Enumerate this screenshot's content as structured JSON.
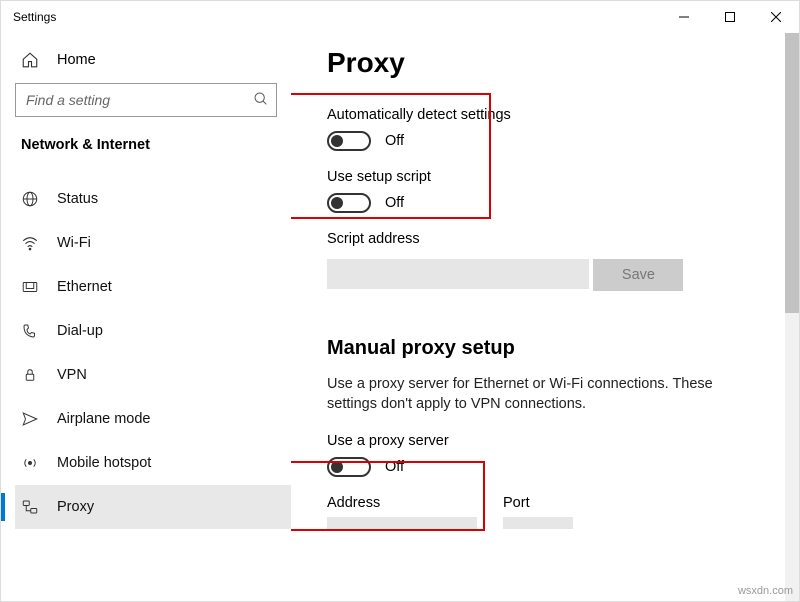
{
  "titlebar": {
    "label": "Settings"
  },
  "sidebar": {
    "home": "Home",
    "search_placeholder": "Find a setting",
    "section": "Network & Internet",
    "items": [
      {
        "label": "Status"
      },
      {
        "label": "Wi-Fi"
      },
      {
        "label": "Ethernet"
      },
      {
        "label": "Dial-up"
      },
      {
        "label": "VPN"
      },
      {
        "label": "Airplane mode"
      },
      {
        "label": "Mobile hotspot"
      },
      {
        "label": "Proxy"
      }
    ]
  },
  "main": {
    "title": "Proxy",
    "auto_detect": {
      "label": "Automatically detect settings",
      "state": "Off"
    },
    "setup_script": {
      "label": "Use setup script",
      "state": "Off"
    },
    "script_address_label": "Script address",
    "save_label": "Save",
    "manual_title": "Manual proxy setup",
    "manual_desc": "Use a proxy server for Ethernet or Wi-Fi connections. These settings don't apply to VPN connections.",
    "use_proxy": {
      "label": "Use a proxy server",
      "state": "Off"
    },
    "address_label": "Address",
    "port_label": "Port"
  },
  "watermark": "wsxdn.com"
}
